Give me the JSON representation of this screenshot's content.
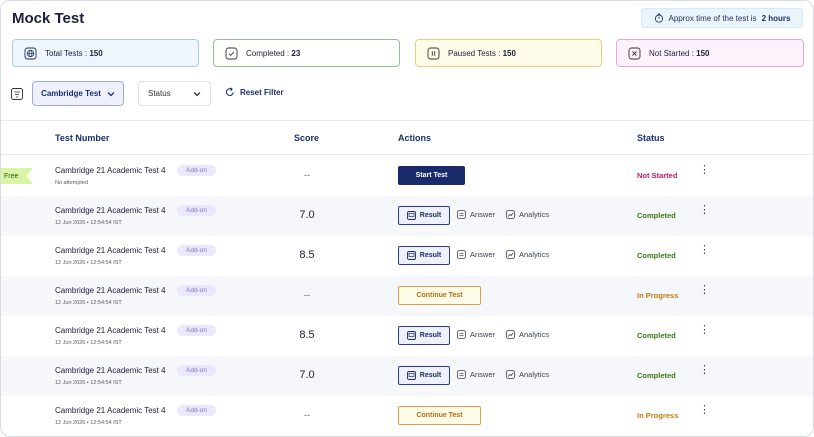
{
  "page_title": "Mock Test",
  "approx": {
    "prefix": "Approx time of the test is",
    "value": "2 hours"
  },
  "stats": [
    {
      "label": "Total Tests :",
      "value": "150"
    },
    {
      "label": "Completed :",
      "value": "23"
    },
    {
      "label": "Paused Tests :",
      "value": "150"
    },
    {
      "label": "Not Started :",
      "value": "150"
    }
  ],
  "filters": {
    "book": "Cambridge Test",
    "status": "Status",
    "reset": "Reset Filter"
  },
  "table": {
    "headers": {
      "test_number": "Test Number",
      "score": "Score",
      "actions": "Actions",
      "status": "Status"
    },
    "rows": [
      {
        "name": "Cambridge 21 Academic Test 4",
        "badge": "Add-on",
        "meta": "No attempted",
        "score": "--",
        "status": "Not Started"
      },
      {
        "name": "Cambridge 21 Academic Test 4",
        "badge": "Add-on",
        "meta": "12 Jun 2026  •  12:54:54  IST",
        "score": "7.0",
        "status": "Completed"
      },
      {
        "name": "Cambridge 21 Academic Test 4",
        "badge": "Add-on",
        "meta": "12 Jun 2026  •  12:54:54  IST",
        "score": "8.5",
        "status": "Completed"
      },
      {
        "name": "Cambridge 21 Academic Test 4",
        "badge": "Add-on",
        "meta": "12 Jun 2026  •  12:54:54  IST",
        "score": "--",
        "status": "In Progress"
      },
      {
        "name": "Cambridge 21 Academic Test 4",
        "badge": "Add-on",
        "meta": "12 Jun 2026  •  12:54:54  IST",
        "score": "8.5",
        "status": "Completed"
      },
      {
        "name": "Cambridge 21 Academic Test 4",
        "badge": "Add-on",
        "meta": "12 Jun 2026  •  12:54:54  IST",
        "score": "7.0",
        "status": "Completed"
      },
      {
        "name": "Cambridge 21 Academic Test 4",
        "badge": "Add-on",
        "meta": "12 Jun 2026  •  12:54:54  IST",
        "score": "--",
        "status": "In Progress"
      }
    ]
  },
  "actions": {
    "start": "Start Test",
    "continue": "Continue Test",
    "result": "Result",
    "answer": "Answer",
    "analytics": "Analytics"
  },
  "free_tag": "Free",
  "kebab_icon": "⋮"
}
